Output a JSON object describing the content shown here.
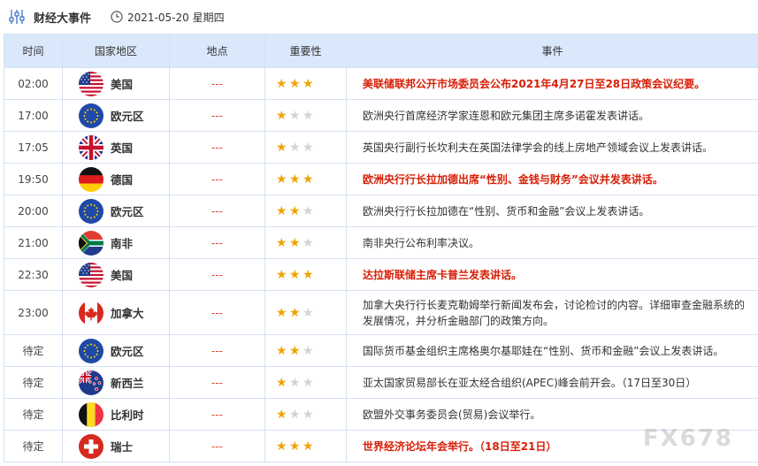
{
  "header": {
    "title": "财经大事件",
    "date": "2021-05-20 星期四"
  },
  "columns": [
    "时间",
    "国家地区",
    "地点",
    "重要性",
    "事件"
  ],
  "colors": {
    "highlight": "#d81e06",
    "star": "#f0a400",
    "header_bg": "#dae8fb"
  },
  "rows": [
    {
      "time": "02:00",
      "country": "美国",
      "flag": "us-flag-icon",
      "location": "---",
      "stars": 3,
      "event": "美联储联邦公开市场委员会公布2021年4月27日至28日政策会议纪要。",
      "highlight": true
    },
    {
      "time": "17:00",
      "country": "欧元区",
      "flag": "eu-flag-icon",
      "location": "---",
      "stars": 1,
      "event": "欧洲央行首席经济学家连恩和欧元集团主席多诺霍发表讲话。",
      "highlight": false
    },
    {
      "time": "17:05",
      "country": "英国",
      "flag": "uk-flag-icon",
      "location": "---",
      "stars": 1,
      "event": "英国央行副行长坎利夫在英国法律学会的线上房地产领域会议上发表讲话。",
      "highlight": false
    },
    {
      "time": "19:50",
      "country": "德国",
      "flag": "de-flag-icon",
      "location": "---",
      "stars": 3,
      "event": "欧洲央行行长拉加德出席“性别、金钱与财务”会议并发表讲话。",
      "highlight": true
    },
    {
      "time": "20:00",
      "country": "欧元区",
      "flag": "eu-flag-icon",
      "location": "---",
      "stars": 2,
      "event": "欧洲央行行长拉加德在“性别、货币和金融”会议上发表讲话。",
      "highlight": false
    },
    {
      "time": "21:00",
      "country": "南非",
      "flag": "za-flag-icon",
      "location": "---",
      "stars": 2,
      "event": "南非央行公布利率决议。",
      "highlight": false
    },
    {
      "time": "22:30",
      "country": "美国",
      "flag": "us-flag-icon",
      "location": "---",
      "stars": 3,
      "event": "达拉斯联储主席卡普兰发表讲话。",
      "highlight": true
    },
    {
      "time": "23:00",
      "country": "加拿大",
      "flag": "ca-flag-icon",
      "location": "---",
      "stars": 2,
      "event": "加拿大央行行长麦克勒姆举行新闻发布会，讨论检讨的内容。详细审查金融系统的发展情况，并分析金融部门的政策方向。",
      "highlight": false,
      "tall": true
    },
    {
      "time": "待定",
      "country": "欧元区",
      "flag": "eu-flag-icon",
      "location": "---",
      "stars": 2,
      "event": "国际货币基金组织主席格奥尔基耶娃在“性别、货币和金融”会议上发表讲话。",
      "highlight": false
    },
    {
      "time": "待定",
      "country": "新西兰",
      "flag": "nz-flag-icon",
      "location": "---",
      "stars": 1,
      "event": "亚太国家贸易部长在亚太经合组织(APEC)峰会前开会。（17日至30日）",
      "highlight": false
    },
    {
      "time": "待定",
      "country": "比利时",
      "flag": "be-flag-icon",
      "location": "---",
      "stars": 1,
      "event": "欧盟外交事务委员会(贸易)会议举行。",
      "highlight": false
    },
    {
      "time": "待定",
      "country": "瑞士",
      "flag": "ch-flag-icon",
      "location": "---",
      "stars": 3,
      "event": "世界经济论坛年会举行。（18日至21日）",
      "highlight": true
    }
  ],
  "watermark": "FX678"
}
